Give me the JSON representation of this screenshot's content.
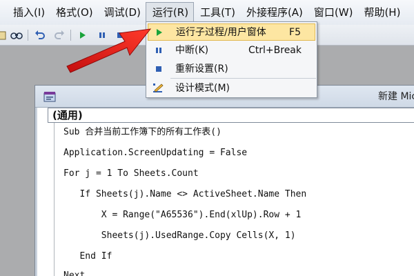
{
  "menubar": {
    "items": [
      {
        "label": "插入(I)"
      },
      {
        "label": "格式(O)"
      },
      {
        "label": "调试(D)"
      },
      {
        "label": "运行(R)"
      },
      {
        "label": "工具(T)"
      },
      {
        "label": "外接程序(A)"
      },
      {
        "label": "窗口(W)"
      },
      {
        "label": "帮助(H)"
      }
    ]
  },
  "toolbar": {
    "icons": [
      "find-icon",
      "undo-icon",
      "redo-icon",
      "run-icon",
      "break-icon",
      "reset-icon"
    ]
  },
  "run_menu": {
    "items": [
      {
        "label": "运行子过程/用户窗体",
        "shortcut": "F5",
        "icon": "run-icon"
      },
      {
        "label": "中断(K)",
        "shortcut": "Ctrl+Break",
        "icon": "break-icon"
      },
      {
        "label": "重新设置(R)",
        "shortcut": "",
        "icon": "reset-icon"
      },
      {
        "label": "设计模式(M)",
        "shortcut": "",
        "icon": "design-mode-icon"
      }
    ]
  },
  "code_window": {
    "title": "新建 Mic",
    "object_combo": "(通用)",
    "lines": [
      "Sub 合并当前工作簿下的所有工作表()",
      "Application.ScreenUpdating = False",
      "For j = 1 To Sheets.Count",
      "   If Sheets(j).Name <> ActiveSheet.Name Then",
      "       X = Range(\"A65536\").End(xlUp).Row + 1",
      "       Sheets(j).UsedRange.Copy Cells(X, 1)",
      "   End If",
      "Next"
    ]
  },
  "colors": {
    "hover_fill": "#fde6a2",
    "arrow": "#e8231c",
    "run_green": "#1aa33a"
  }
}
